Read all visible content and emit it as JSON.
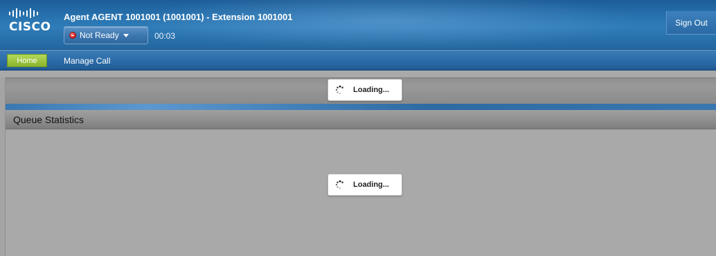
{
  "header": {
    "logo_text": "CISCO",
    "agent_title": "Agent AGENT 1001001 (1001001) - Extension 1001001",
    "state": {
      "label": "Not Ready",
      "timer": "00:03",
      "icon": "not-ready-icon",
      "status_color": "#d21f1f"
    },
    "signout_label": "Sign Out"
  },
  "nav": {
    "home_label": "Home",
    "home_color": "#9cc43c",
    "manage_call_label": "Manage Call"
  },
  "panels": {
    "top_loading": "Loading...",
    "queue_statistics": {
      "title": "Queue Statistics",
      "loading": "Loading..."
    }
  },
  "icons": {
    "spinner": "loading-spinner-icon",
    "caret": "chevron-down-icon"
  }
}
